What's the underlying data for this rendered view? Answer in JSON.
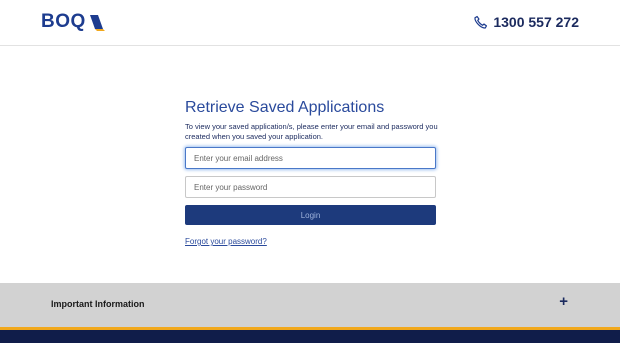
{
  "header": {
    "logo_text": "BOQ",
    "phone_number": "1300 557 272"
  },
  "main": {
    "title": "Retrieve Saved Applications",
    "description": "To view your saved application/s, please enter your email and password you created when you saved your application.",
    "email_placeholder": "Enter your email address",
    "password_placeholder": "Enter your password",
    "login_label": "Login",
    "forgot_label": "Forgot your password?"
  },
  "info": {
    "label": "Important Information",
    "expand_symbol": "+"
  },
  "colors": {
    "brand_navy": "#1d3a7c",
    "accent_gold": "#f1a81c",
    "footer_navy": "#101d4a"
  }
}
